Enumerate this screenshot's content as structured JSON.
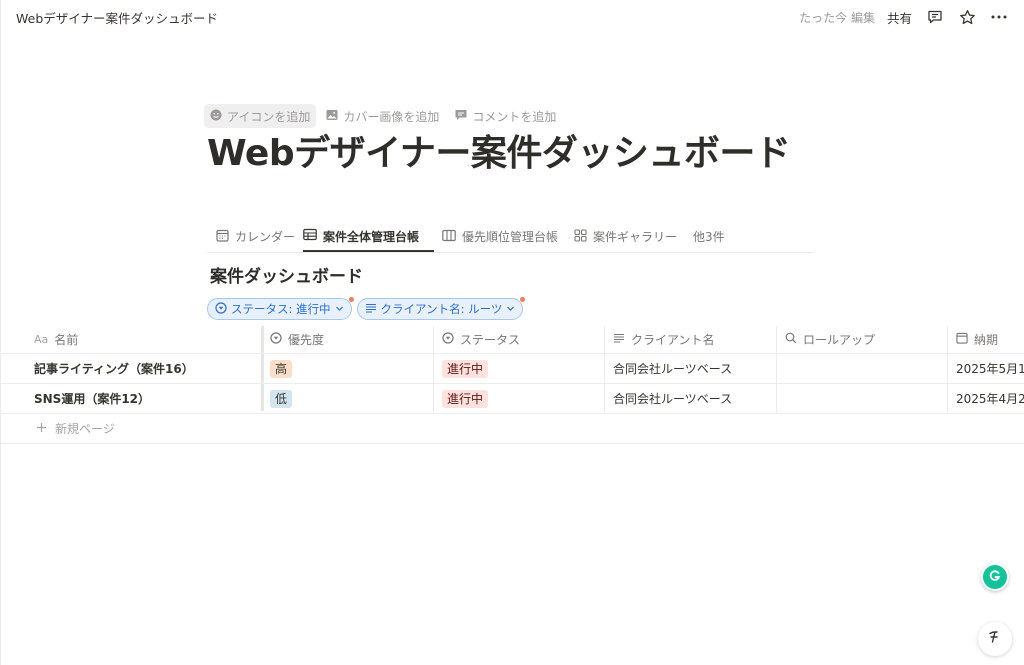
{
  "topbar": {
    "breadcrumb": "Webデザイナー案件ダッシュボード",
    "edited": "たった今 編集",
    "share": "共有",
    "icons": [
      "comment-icon",
      "star-icon",
      "more-icon"
    ]
  },
  "page_actions": [
    {
      "label": "アイコンを追加",
      "icon": "smiley-icon"
    },
    {
      "label": "カバー画像を追加",
      "icon": "image-icon"
    },
    {
      "label": "コメントを追加",
      "icon": "comment-icon"
    }
  ],
  "title": "Webデザイナー案件ダッシュボード",
  "tabs": [
    {
      "label": "カレンダー",
      "icon": "calendar-icon",
      "active": false
    },
    {
      "label": "案件全体管理台帳",
      "icon": "table-icon",
      "active": true
    },
    {
      "label": "優先順位管理台帳",
      "icon": "board-icon",
      "active": false
    },
    {
      "label": "案件ギャラリー",
      "icon": "gallery-icon",
      "active": false
    },
    {
      "label": "他3件",
      "icon": "",
      "active": false
    }
  ],
  "view_title": "案件ダッシュボード",
  "filters": [
    {
      "label": "ステータス: 進行中",
      "icon": "status-icon"
    },
    {
      "label": "クライアント名: ルーツ",
      "icon": "text-lines-icon"
    }
  ],
  "table": {
    "headers": {
      "name": {
        "label": "名前",
        "icon_text": "Aa"
      },
      "priority": {
        "label": "優先度",
        "icon": "select-icon"
      },
      "status": {
        "label": "ステータス",
        "icon": "status-icon"
      },
      "client": {
        "label": "クライアント名",
        "icon": "text-lines-icon"
      },
      "rollup": {
        "label": "ロールアップ",
        "icon": "search-icon"
      },
      "due": {
        "label": "納期",
        "icon": "calendar-icon"
      }
    },
    "rows": [
      {
        "name": "記事ライティング（案件16）",
        "priority": "高",
        "status": "進行中",
        "client": "合同会社ルーツベース",
        "rollup": "",
        "due": "2025年5月1"
      },
      {
        "name": "SNS運用（案件12）",
        "priority": "低",
        "status": "進行中",
        "client": "合同会社ルーツベース",
        "rollup": "",
        "due": "2025年4月2"
      }
    ],
    "new_page": "新規ページ"
  },
  "colors": {
    "text": "#37352f",
    "muted": "#9b9a97",
    "filter_chip": "#2f6fc9",
    "tag_high": "#fadec9",
    "tag_low": "#d3e5ef",
    "tag_in_progress": "#ffe2dd",
    "grammarly": "#15c39a"
  }
}
